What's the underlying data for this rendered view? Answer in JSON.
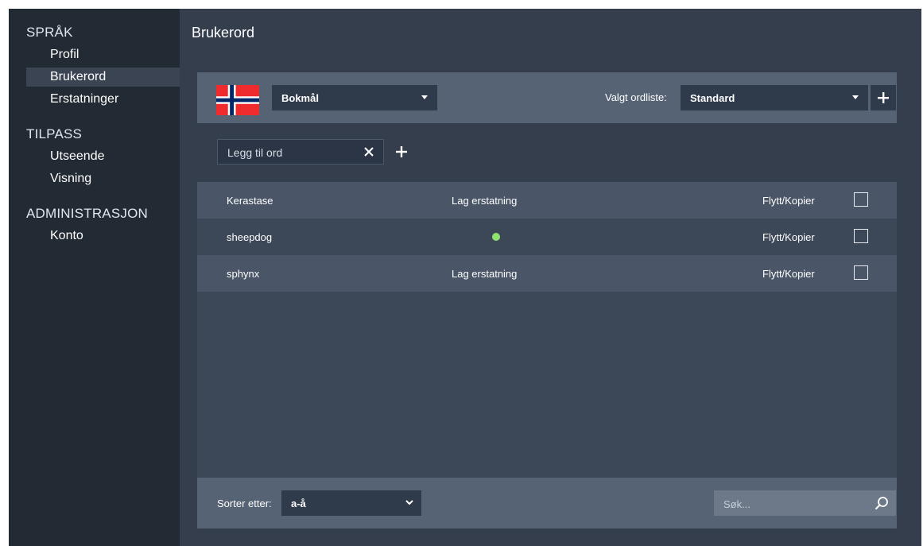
{
  "sidebar": {
    "sections": [
      {
        "heading": "SPRÅK",
        "items": [
          {
            "label": "Profil",
            "active": false
          },
          {
            "label": "Brukerord",
            "active": true
          },
          {
            "label": "Erstatninger",
            "active": false
          }
        ]
      },
      {
        "heading": "TILPASS",
        "items": [
          {
            "label": "Utseende",
            "active": false
          },
          {
            "label": "Visning",
            "active": false
          }
        ]
      },
      {
        "heading": "ADMINISTRASJON",
        "items": [
          {
            "label": "Konto",
            "active": false
          }
        ]
      }
    ]
  },
  "main": {
    "title": "Brukerord",
    "language": {
      "selected": "Bokmål",
      "flag_icon": "norway-flag-icon"
    },
    "wordlist": {
      "label": "Valgt ordliste:",
      "selected": "Standard"
    },
    "add_word": {
      "placeholder": "Legg til ord"
    },
    "words": [
      {
        "word": "Kerastase",
        "replacement": "Lag erstatning",
        "has_replacement": false,
        "move": "Flytt/Kopier",
        "checked": false
      },
      {
        "word": "sheepdog",
        "replacement": "",
        "has_replacement": true,
        "move": "Flytt/Kopier",
        "checked": false
      },
      {
        "word": "sphynx",
        "replacement": "Lag erstatning",
        "has_replacement": false,
        "move": "Flytt/Kopier",
        "checked": false
      }
    ],
    "sort": {
      "label": "Sorter etter:",
      "selected": "a-å"
    },
    "search": {
      "placeholder": "Søk..."
    }
  },
  "colors": {
    "sidebar_bg": "#222a34",
    "main_bg": "#343e4d",
    "panel_header": "#566374",
    "status_green": "#8ee36f"
  }
}
